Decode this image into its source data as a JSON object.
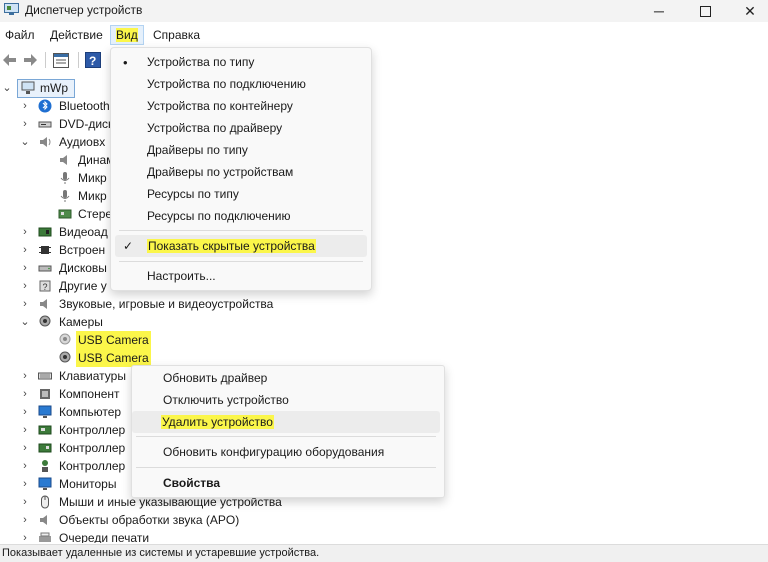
{
  "window": {
    "title": "Диспетчер устройств"
  },
  "menubar": [
    "Файл",
    "Действие",
    "Вид",
    "Справка"
  ],
  "view_menu": {
    "items": [
      "Устройства по типу",
      "Устройства по подключению",
      "Устройства по контейнеру",
      "Устройства по драйверу",
      "Драйверы по типу",
      "Драйверы по устройствам",
      "Ресурсы по типу",
      "Ресурсы по подключению"
    ],
    "show_hidden": "Показать скрытые устройства",
    "customize": "Настроить..."
  },
  "tree": {
    "root": "mWp",
    "items": [
      "Bluetooth",
      "DVD-диск",
      "Аудиовх",
      "Динам",
      "Микр",
      "Микр",
      "Стере",
      "Видеоад",
      "Встроен",
      "Дисковы",
      "Другие у",
      "Звуковые, игровые и видеоустройства",
      "Камеры",
      "USB Camera",
      "USB Camera",
      "Клавиатуры",
      "Компонент",
      "Компьютер",
      "Контроллер",
      "Контроллер",
      "Контроллер",
      "Мониторы",
      "Мыши и иные указывающие устройства",
      "Объекты обработки звука (APO)",
      "Очереди печати"
    ]
  },
  "context_menu": [
    "Обновить драйвер",
    "Отключить устройство",
    "Удалить устройство",
    "Обновить конфигурацию оборудования",
    "Свойства"
  ],
  "status": "Показывает удаленные из системы и устаревшие устройства.",
  "colors": {
    "highlight": "#fbf64a",
    "accent": "#0067c0"
  }
}
